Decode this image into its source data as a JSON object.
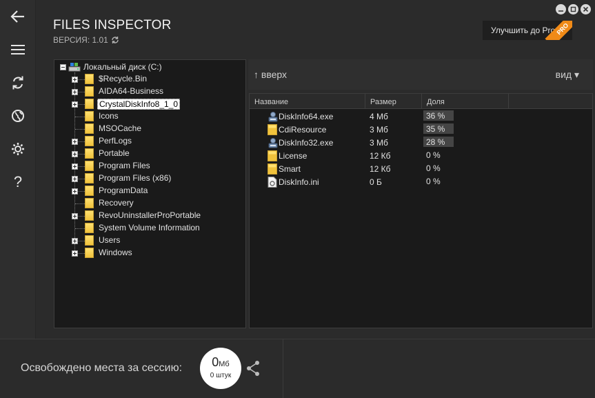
{
  "header": {
    "title": "FILES INSPECTOR",
    "version": "ВЕРСИЯ: 1.01",
    "upgrade_label": "Улучшить до Pro",
    "pro_badge": "PRO"
  },
  "nav": {
    "icons": [
      "back-arrow-icon",
      "menu-icon",
      "refresh-icon",
      "globe-icon",
      "gear-icon",
      "help-icon"
    ],
    "help_label": "?"
  },
  "tree": {
    "root_label": "Локальный диск (C:)",
    "items": [
      {
        "label": "$Recycle.Bin",
        "expandable": true
      },
      {
        "label": "AIDA64-Business",
        "expandable": true
      },
      {
        "label": "CrystalDiskInfo8_1_0",
        "expandable": true,
        "selected": true
      },
      {
        "label": "Icons",
        "expandable": false
      },
      {
        "label": "MSOCache",
        "expandable": false
      },
      {
        "label": "PerfLogs",
        "expandable": true
      },
      {
        "label": "Portable",
        "expandable": true
      },
      {
        "label": "Program Files",
        "expandable": true
      },
      {
        "label": "Program Files (x86)",
        "expandable": true
      },
      {
        "label": "ProgramData",
        "expandable": true
      },
      {
        "label": "Recovery",
        "expandable": false
      },
      {
        "label": "RevoUninstallerProPortable",
        "expandable": true
      },
      {
        "label": "System Volume Information",
        "expandable": false
      },
      {
        "label": "Users",
        "expandable": true
      },
      {
        "label": "Windows",
        "expandable": true
      }
    ]
  },
  "files": {
    "up_label": "↑ вверх",
    "view_label": "вид ▾",
    "columns": [
      "Название",
      "Размер",
      "Доля"
    ],
    "rows": [
      {
        "name": "DiskInfo64.exe",
        "size": "4 Мб",
        "share": "36 %",
        "icon": "exe-icon",
        "bar": true
      },
      {
        "name": "CdiResource",
        "size": "3 Мб",
        "share": "35 %",
        "icon": "folder-icon",
        "bar": true
      },
      {
        "name": "DiskInfo32.exe",
        "size": "3 Мб",
        "share": "28 %",
        "icon": "exe-icon",
        "bar": true
      },
      {
        "name": "License",
        "size": "12 Кб",
        "share": "0 %",
        "icon": "folder-icon",
        "bar": false
      },
      {
        "name": "Smart",
        "size": "12 Кб",
        "share": "0 %",
        "icon": "folder-icon",
        "bar": false
      },
      {
        "name": "DiskInfo.ini",
        "size": "0 Б",
        "share": "0 %",
        "icon": "ini-file-icon",
        "bar": false
      }
    ]
  },
  "footer": {
    "freed_label": "Освобождено места за сессию:",
    "freed_value": "0",
    "freed_unit": "Мб",
    "freed_count": "0 штук"
  },
  "colors": {
    "background": "#2b2b2b",
    "panel": "#1a1a1a",
    "accent": "#f08a17",
    "folder": "#f0c23c"
  }
}
